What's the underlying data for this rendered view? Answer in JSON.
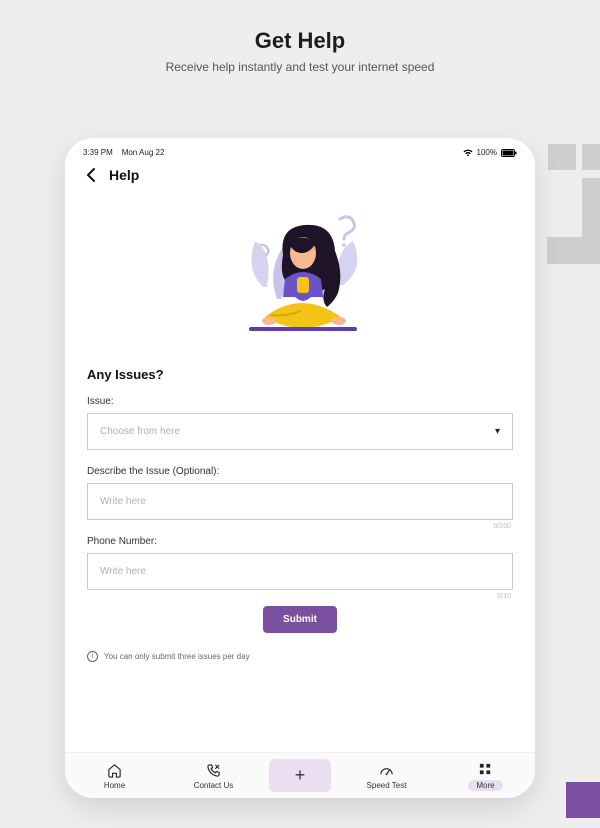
{
  "page": {
    "title": "Get Help",
    "subtitle": "Receive help instantly and test your internet speed"
  },
  "statusBar": {
    "time": "3:39 PM",
    "date": "Mon Aug 22",
    "batteryPct": "100%"
  },
  "header": {
    "title": "Help"
  },
  "form": {
    "sectionTitle": "Any Issues?",
    "issue": {
      "label": "Issue:",
      "placeholder": "Choose from here"
    },
    "describe": {
      "label": "Describe the Issue (Optional):",
      "placeholder": "Write here",
      "counter": "0/200"
    },
    "phone": {
      "label": "Phone Number:",
      "placeholder": "Write here",
      "counter": "0/10"
    },
    "submitLabel": "Submit",
    "infoText": "You can only submit three issues per day"
  },
  "nav": {
    "home": "Home",
    "contact": "Contact Us",
    "speed": "Speed Test",
    "more": "More"
  }
}
